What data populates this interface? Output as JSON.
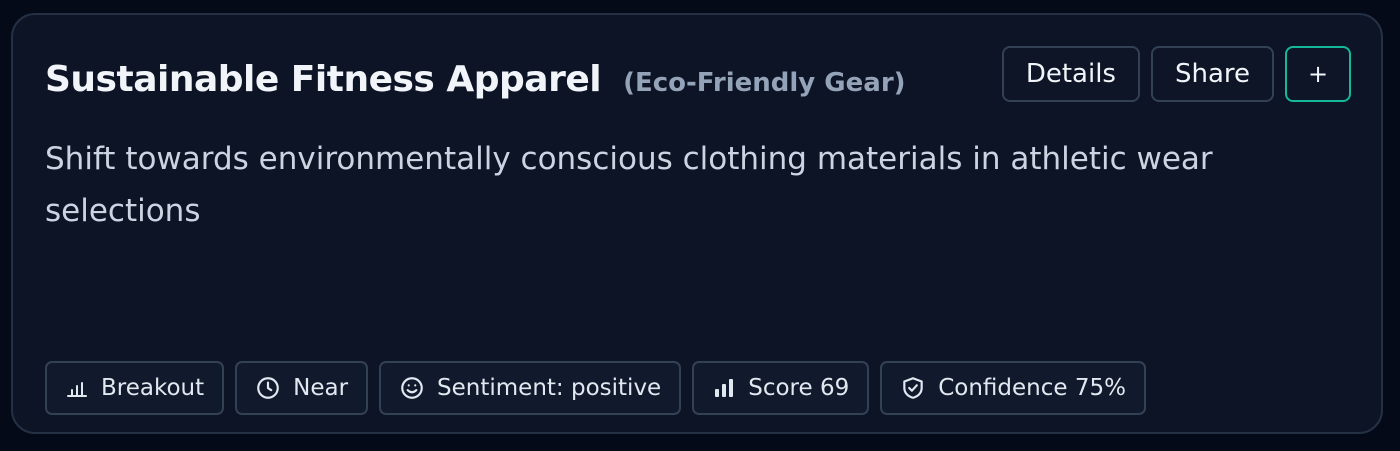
{
  "card": {
    "title": "Sustainable Fitness Apparel",
    "category": "(Eco-Friendly Gear)",
    "description": "Shift towards environmentally conscious clothing materials in athletic wear selections"
  },
  "actions": {
    "details_label": "Details",
    "share_label": "Share",
    "add_label": "+"
  },
  "tags": [
    {
      "icon": "bar-chart-icon",
      "label": "Breakout"
    },
    {
      "icon": "clock-icon",
      "label": "Near"
    },
    {
      "icon": "smile-icon",
      "label": "Sentiment: positive"
    },
    {
      "icon": "signal-bars-icon",
      "label": "Score 69"
    },
    {
      "icon": "shield-check-icon",
      "label": "Confidence 75%"
    }
  ],
  "colors": {
    "background": "#040a17",
    "card": "#0c1426",
    "accent_border": "#14b89a"
  }
}
